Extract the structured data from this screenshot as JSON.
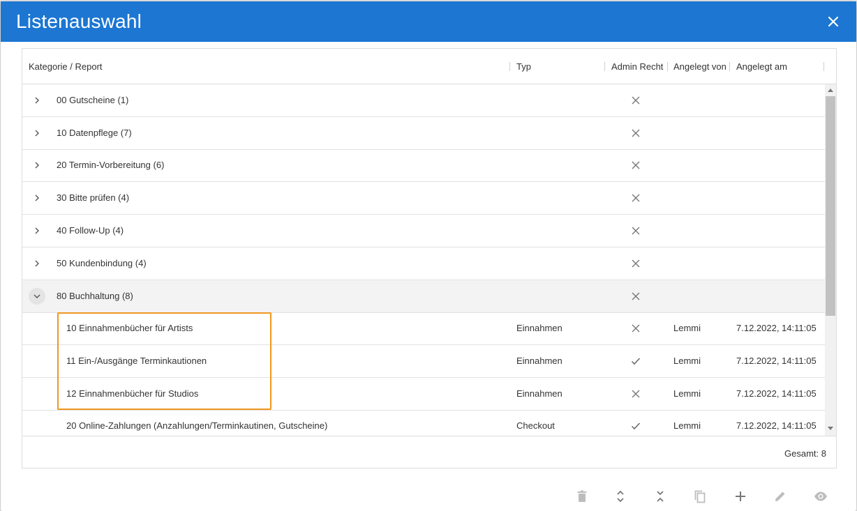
{
  "dialog": {
    "title": "Listenauswahl"
  },
  "grid": {
    "columns": {
      "category": "Kategorie / Report",
      "type": "Typ",
      "admin": "Admin Recht",
      "created_by": "Angelegt von",
      "created_at": "Angelegt am"
    },
    "categories": [
      {
        "label": "00 Gutscheine (1)",
        "admin": "no"
      },
      {
        "label": "10 Datenpflege (7)",
        "admin": "no"
      },
      {
        "label": "20 Termin-Vorbereitung (6)",
        "admin": "no"
      },
      {
        "label": "30 Bitte prüfen (4)",
        "admin": "no"
      },
      {
        "label": "40 Follow-Up (4)",
        "admin": "no"
      },
      {
        "label": "50 Kundenbindung (4)",
        "admin": "no"
      },
      {
        "label": "80 Buchhaltung (8)",
        "admin": "no",
        "expanded": true
      }
    ],
    "reports": [
      {
        "label": "10 Einnahmenbücher für Artists",
        "type": "Einnahmen",
        "admin": "no",
        "created_by": "Lemmi",
        "created_at": "7.12.2022, 14:11:05"
      },
      {
        "label": "11 Ein-/Ausgänge Terminkautionen",
        "type": "Einnahmen",
        "admin": "yes",
        "created_by": "Lemmi",
        "created_at": "7.12.2022, 14:11:05"
      },
      {
        "label": "12 Einnahmenbücher für Studios",
        "type": "Einnahmen",
        "admin": "no",
        "created_by": "Lemmi",
        "created_at": "7.12.2022, 14:11:05"
      },
      {
        "label": "20 Online-Zahlungen (Anzahlungen/Terminkautinen, Gutscheine)",
        "type": "Checkout",
        "admin": "yes",
        "created_by": "Lemmi",
        "created_at": "7.12.2022, 14:11:05"
      }
    ],
    "footer_total": "Gesamt: 8"
  },
  "toolbar": {
    "icons": [
      "delete-icon",
      "expand-all-icon",
      "collapse-all-icon",
      "copy-icon",
      "add-icon",
      "edit-icon",
      "view-icon"
    ]
  },
  "colors": {
    "header_bg": "#1c76d2",
    "highlight": "#f0961f"
  }
}
